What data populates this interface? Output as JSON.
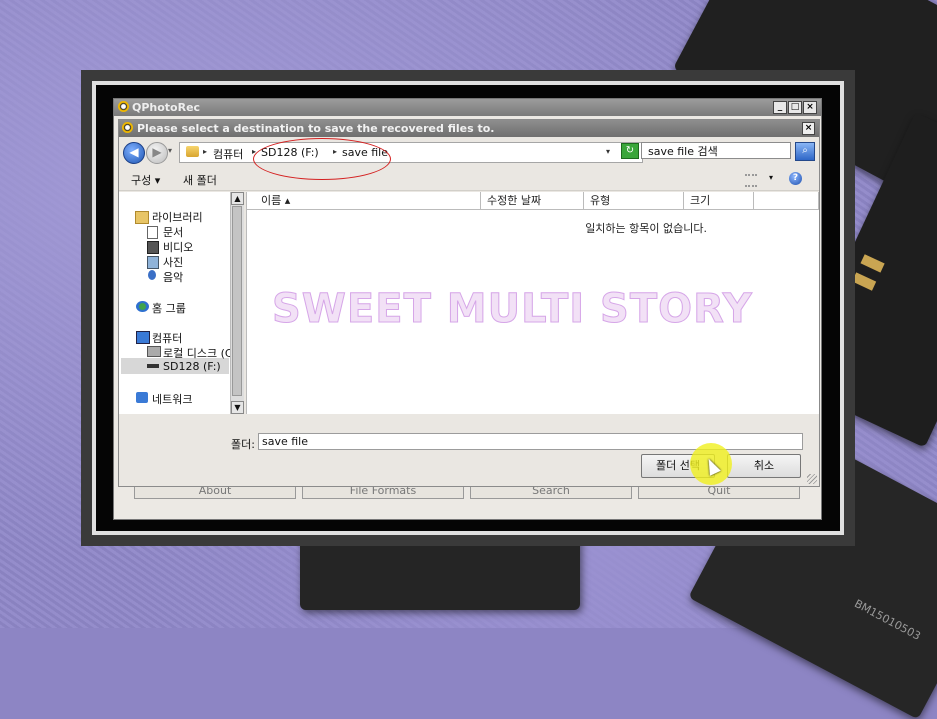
{
  "app": {
    "title": "QPhotoRec",
    "window_buttons": [
      "_",
      "□",
      "×"
    ],
    "bottom_buttons": [
      "About",
      "File Formats",
      "Search",
      "Quit"
    ]
  },
  "dialog": {
    "title": "Please select a destination to save the recovered files to.",
    "close": "×",
    "breadcrumb": [
      "컴퓨터",
      "SD128 (F:)",
      "save file"
    ],
    "search_placeholder": "save file 검색",
    "toolbar": {
      "organize": "구성 ▾",
      "new_folder": "새 폴더"
    },
    "nav": {
      "libraries": "라이브러리",
      "documents": "문서",
      "videos": "비디오",
      "pictures": "사진",
      "music": "음악",
      "homegroup": "홈 그룹",
      "computer": "컴퓨터",
      "local_disk": "로컬 디스크 (C",
      "sd": "SD128 (F:)",
      "network": "네트워크"
    },
    "columns": {
      "name": "이름 ▴",
      "date": "수정한 날짜",
      "type": "유형",
      "size": "크기"
    },
    "empty_message": "일치하는 항목이 없습니다.",
    "folder_label": "폴더:",
    "folder_value": "save file",
    "select_button": "폴더 선택",
    "cancel_button": "취소"
  },
  "watermark": "SWEET MULTI STORY",
  "card_text": "BM15010503"
}
